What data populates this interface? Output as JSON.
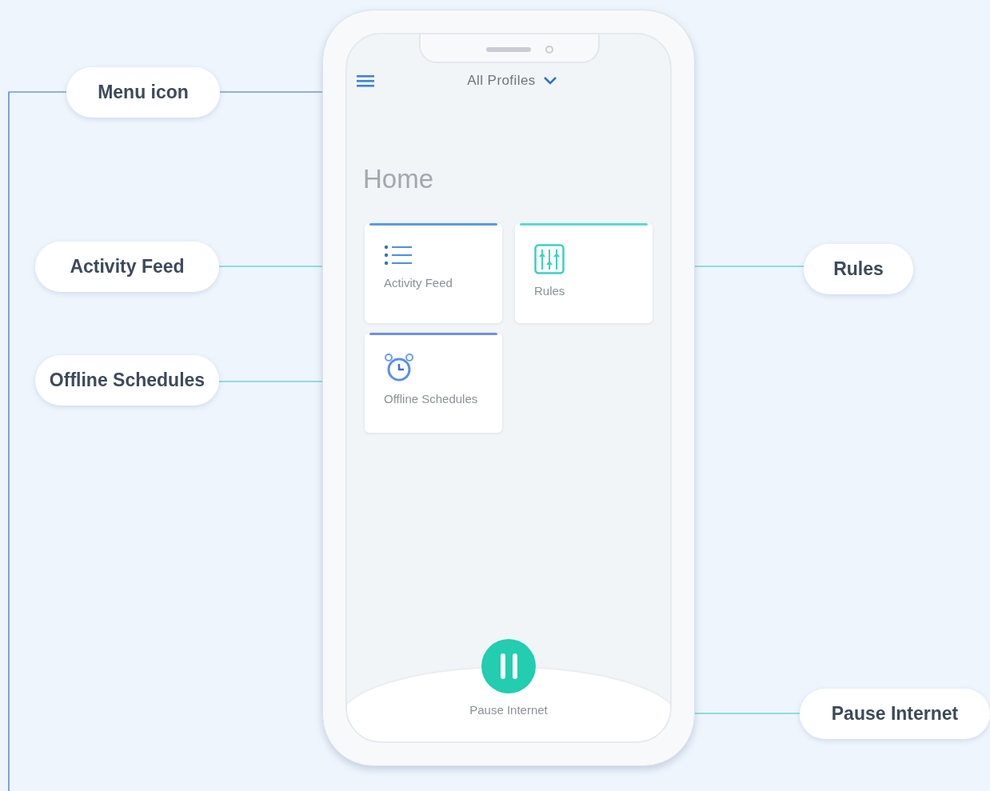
{
  "phone": {
    "header": {
      "profile_selector": "All Profiles"
    },
    "title": "Home",
    "tiles": [
      {
        "kind": "list",
        "label": "Activity Feed",
        "color": "#5b9be0"
      },
      {
        "kind": "sliders",
        "label": "Rules",
        "color": "#5fd8cf"
      },
      {
        "kind": "alarm",
        "label": "Offline Schedules",
        "color": "#6f8fe6"
      }
    ],
    "pause_button": {
      "label": "Pause Internet"
    }
  },
  "callouts": [
    {
      "label": "Menu icon"
    },
    {
      "label": "Activity Feed"
    },
    {
      "label": "Offline Schedules"
    },
    {
      "label": "Rules"
    },
    {
      "label": "Pause Internet"
    }
  ]
}
